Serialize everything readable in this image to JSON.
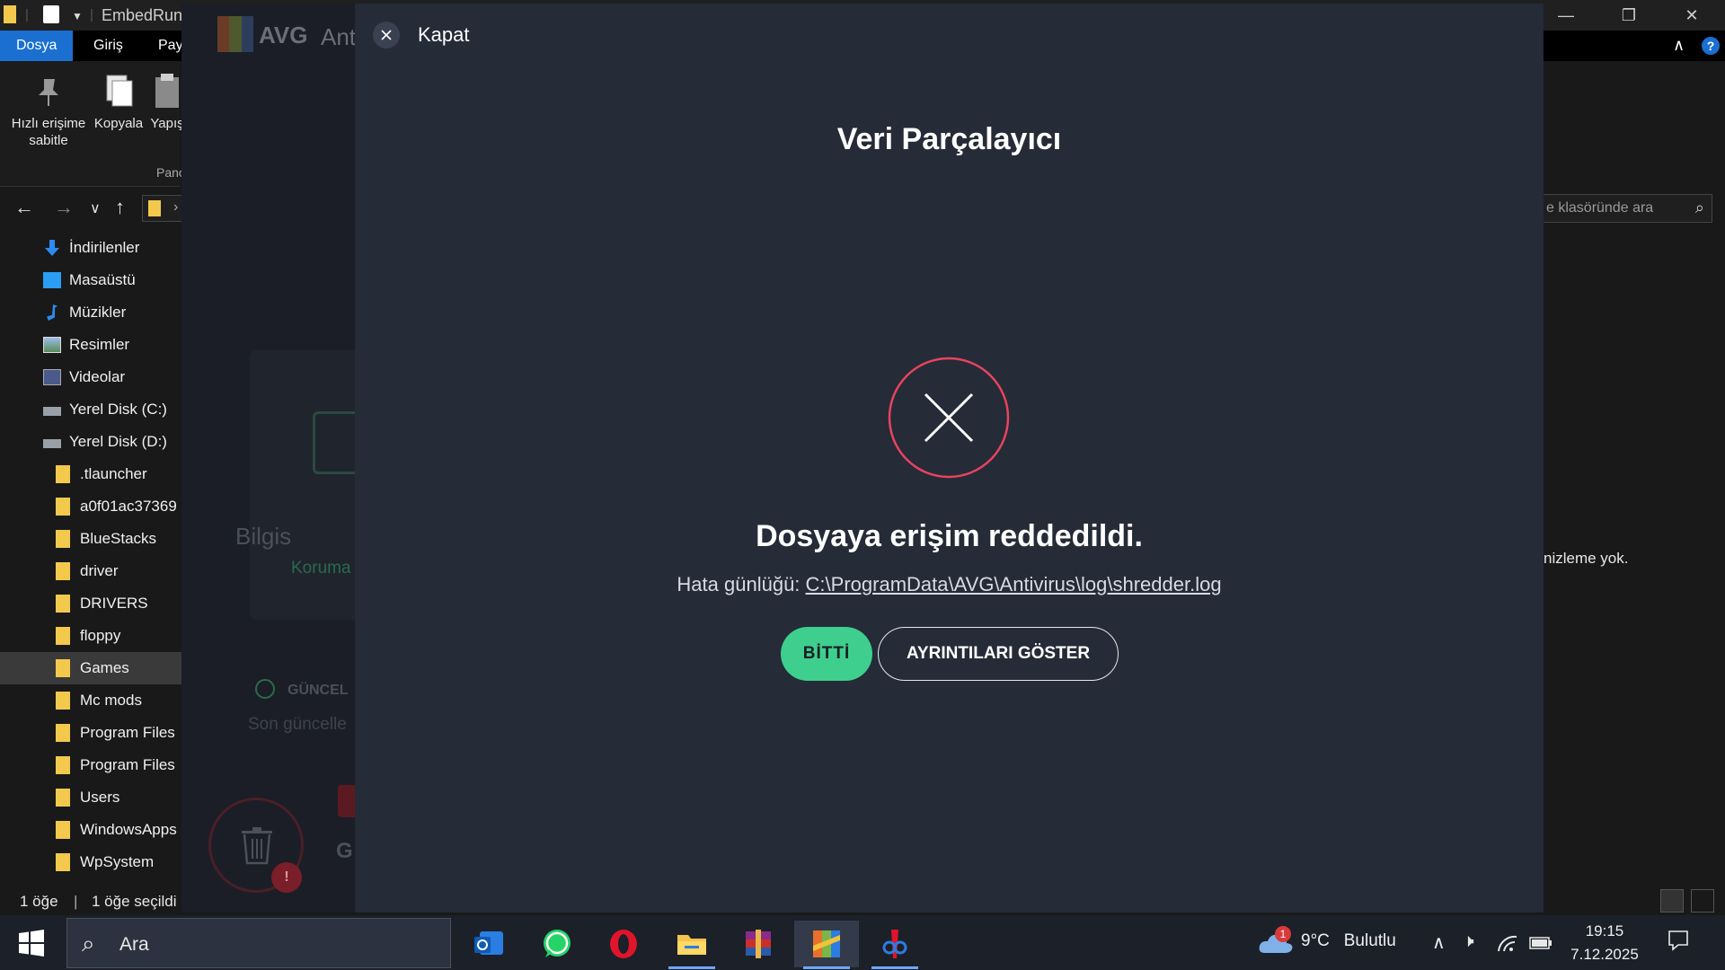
{
  "explorer": {
    "title": "EmbedRunt",
    "tabs": [
      "Dosya",
      "Giriş",
      "Payl"
    ],
    "ribbon": {
      "pin_label": "Hızlı erişime sabitle",
      "copy_label": "Kopyala",
      "paste_label": "Yapış",
      "group_label": "Pano"
    },
    "tree": [
      {
        "label": "İndirilenler",
        "icon": "download-icon"
      },
      {
        "label": "Masaüstü",
        "icon": "desktop-icon"
      },
      {
        "label": "Müzikler",
        "icon": "music-icon"
      },
      {
        "label": "Resimler",
        "icon": "pictures-icon"
      },
      {
        "label": "Videolar",
        "icon": "video-icon"
      },
      {
        "label": "Yerel Disk (C:)",
        "icon": "drive-icon"
      },
      {
        "label": "Yerel Disk (D:)",
        "icon": "drive-icon"
      },
      {
        "label": ".tlauncher",
        "icon": "folder-icon"
      },
      {
        "label": "a0f01ac37369",
        "icon": "folder-icon"
      },
      {
        "label": "BlueStacks",
        "icon": "folder-icon"
      },
      {
        "label": "driver",
        "icon": "folder-icon"
      },
      {
        "label": "DRIVERS",
        "icon": "folder-icon"
      },
      {
        "label": "floppy",
        "icon": "folder-icon"
      },
      {
        "label": "Games",
        "icon": "folder-icon",
        "selected": true
      },
      {
        "label": "Mc mods",
        "icon": "folder-icon"
      },
      {
        "label": "Program Files",
        "icon": "folder-icon"
      },
      {
        "label": "Program Files",
        "icon": "folder-icon"
      },
      {
        "label": "Users",
        "icon": "folder-icon"
      },
      {
        "label": "WindowsApps",
        "icon": "folder-icon"
      },
      {
        "label": "WpSystem",
        "icon": "folder-icon"
      }
    ],
    "search_placeholder": "e klasöründe ara",
    "preview_text": "nizleme yok.",
    "status_count": "1 öğe",
    "status_selected": "1 öğe seçildi"
  },
  "avg_app": {
    "brand": "AVG",
    "brand_suffix": "Ant",
    "card_title": "Bilgis",
    "card_sub": "Koruma",
    "update_label": "GÜNCEL",
    "update_sub": "Son güncelle",
    "g_label": "G"
  },
  "dialog": {
    "close_label": "Kapat",
    "title": "Veri Parçalayıcı",
    "error_message": "Dosyaya erişim reddedildi.",
    "log_prefix": "Hata günlüğü:",
    "log_path": "C:\\ProgramData\\AVG\\Antivirus\\log\\shredder.log",
    "done_button": "BİTTİ",
    "details_button": "AYRINTILARI GÖSTER",
    "accent_color": "#3ecf8e",
    "error_color": "#e8435f"
  },
  "taskbar": {
    "search_placeholder": "Ara",
    "weather_temp": "9°C",
    "weather_desc": "Bulutlu",
    "weather_badge": "1",
    "time": "19:15",
    "date": "7.12.2025"
  }
}
